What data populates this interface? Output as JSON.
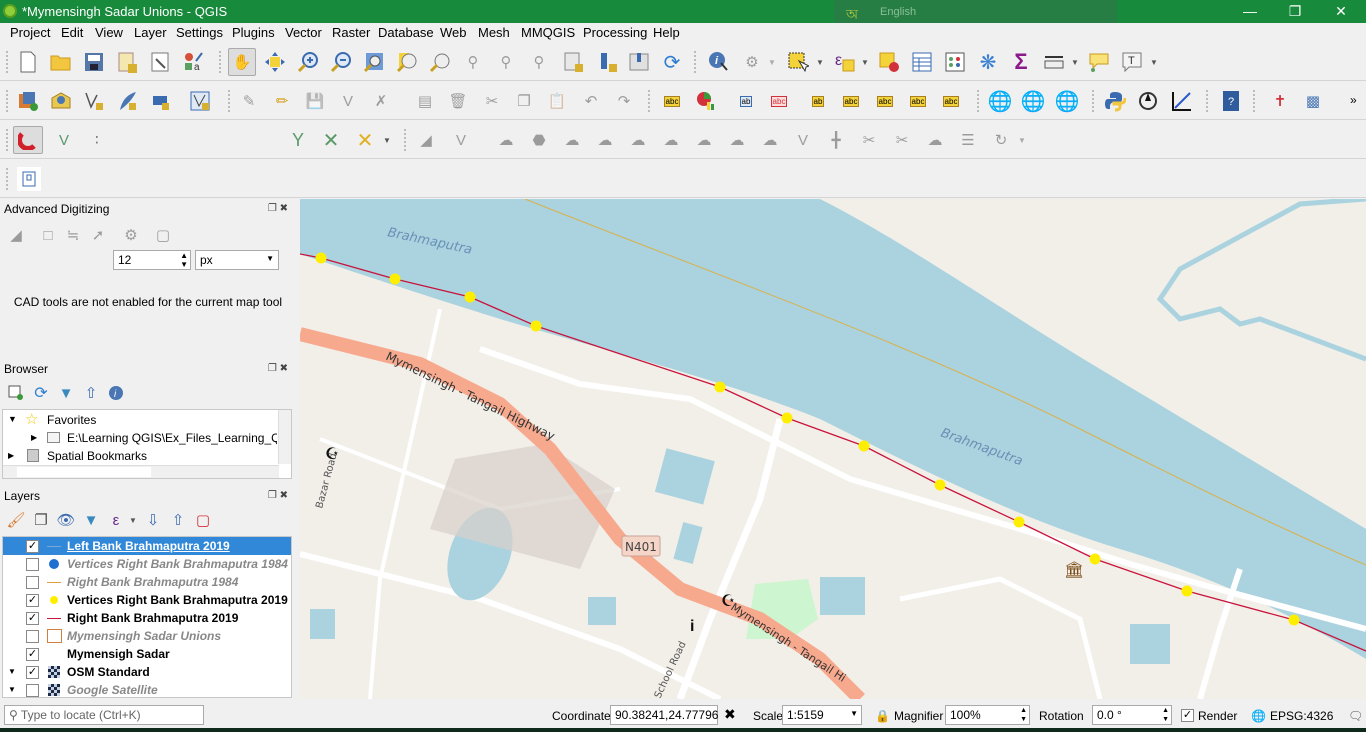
{
  "window": {
    "title": "*Mymensingh Sadar Unions - QGIS",
    "controls": [
      "minimize",
      "restore",
      "close"
    ]
  },
  "ime_bar": {
    "language": "English"
  },
  "menu": [
    "Project",
    "Edit",
    "View",
    "Layer",
    "Settings",
    "Plugins",
    "Vector",
    "Raster",
    "Database",
    "Web",
    "Mesh",
    "MMQGIS",
    "Processing",
    "Help"
  ],
  "snapping": {
    "tolerance": "12",
    "units": "px"
  },
  "advanced_digitizing": {
    "title": "Advanced Digitizing",
    "message": "CAD tools are not enabled for the current map tool"
  },
  "browser": {
    "title": "Browser",
    "items": [
      {
        "label": "Favorites",
        "icon": "star-icon",
        "expanded": true
      },
      {
        "label": "E:\\Learning QGIS\\Ex_Files_Learning_QGIS",
        "icon": "folder-icon",
        "child": true
      },
      {
        "label": "Spatial Bookmarks",
        "icon": "bookmark-icon"
      }
    ]
  },
  "layers": {
    "title": "Layers",
    "items": [
      {
        "name": "Left Bank Brahmaputra 2019",
        "checked": true,
        "selected": true,
        "symbol": "line",
        "color": "#7aa7d6",
        "visible": true
      },
      {
        "name": "Vertices Right Bank Brahmaputra 1984",
        "checked": false,
        "symbol": "point",
        "color": "#1f6fd1",
        "visible": false
      },
      {
        "name": "Right Bank Brahmaputra 1984",
        "checked": false,
        "symbol": "line",
        "color": "#e0a040",
        "visible": false
      },
      {
        "name": "Vertices Right Bank Brahmaputra 2019",
        "checked": true,
        "symbol": "point",
        "color": "#ffee00",
        "visible": true
      },
      {
        "name": "Right Bank Brahmaputra 2019",
        "checked": true,
        "symbol": "line",
        "color": "#c8143c",
        "visible": true
      },
      {
        "name": "Mymensingh Sadar Unions",
        "checked": false,
        "symbol": "polygon",
        "color": "#d08040",
        "visible": false
      },
      {
        "name": "Mymensigh Sadar",
        "checked": true,
        "symbol": "none",
        "color": "",
        "visible": true
      },
      {
        "name": "OSM Standard",
        "checked": true,
        "symbol": "raster",
        "color": "",
        "visible": true,
        "group": true
      },
      {
        "name": "Google Satellite",
        "checked": false,
        "symbol": "raster",
        "color": "",
        "visible": false,
        "group": true
      }
    ]
  },
  "map": {
    "labels": {
      "river1": "Brahmaputra",
      "river2": "Brahmaputra",
      "highway1": "Mymensingh - Tangail Highway",
      "highway2": "Mymensingh - Tangail Hi",
      "shield": "N401",
      "road1": "Bazar Road",
      "road2": "School Road"
    },
    "colors": {
      "water": "#aad3df",
      "land": "#f2efe9",
      "highway": "#f7a98e",
      "vertex": "#ffee00",
      "bank2019": "#c8143c",
      "bank1984": "#d9b04a"
    }
  },
  "status": {
    "locate_placeholder": "Type to locate (Ctrl+K)",
    "coordinate_label": "Coordinate",
    "coordinate": "90.38241,24.77796",
    "scale_label": "Scale",
    "scale": "1:5159",
    "magnifier_label": "Magnifier",
    "magnifier": "100%",
    "rotation_label": "Rotation",
    "rotation": "0.0 °",
    "render_label": "Render",
    "render": true,
    "crs": "EPSG:4326"
  }
}
